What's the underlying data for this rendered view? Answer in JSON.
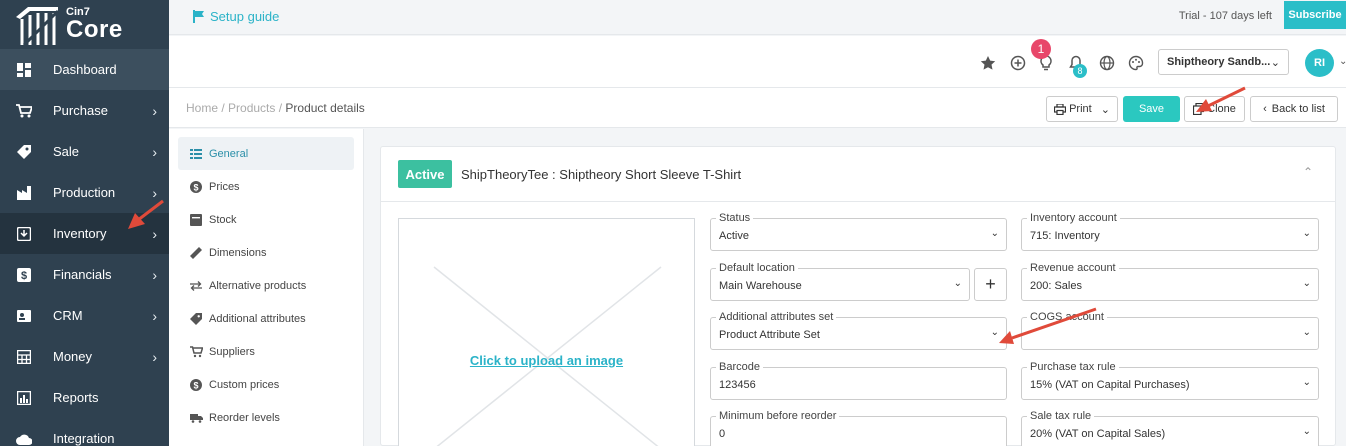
{
  "brand": {
    "small": "Cin7",
    "big": "Core"
  },
  "sidebar": {
    "items": [
      {
        "label": "Dashboard",
        "icon": "dashboard-icon",
        "glyph": "▦"
      },
      {
        "label": "Purchase",
        "icon": "cart-icon",
        "glyph": "🛒"
      },
      {
        "label": "Sale",
        "icon": "tag-icon",
        "glyph": "◆"
      },
      {
        "label": "Production",
        "icon": "factory-icon",
        "glyph": "▙"
      },
      {
        "label": "Inventory",
        "icon": "inventory-icon",
        "glyph": "▣"
      },
      {
        "label": "Financials",
        "icon": "dollar-icon",
        "glyph": "$"
      },
      {
        "label": "CRM",
        "icon": "contact-icon",
        "glyph": "▤"
      },
      {
        "label": "Money",
        "icon": "calculator-icon",
        "glyph": "▦"
      },
      {
        "label": "Reports",
        "icon": "report-icon",
        "glyph": "▥"
      },
      {
        "label": "Integration",
        "icon": "cloud-icon",
        "glyph": "☁"
      }
    ]
  },
  "topbar": {
    "setup_label": "Setup guide",
    "trial": "Trial - 107 days left",
    "subscribe": "Subscribe"
  },
  "header": {
    "notification_count": "1",
    "bell_count": "8",
    "company": "Shiptheory Sandb...",
    "avatar": "RI"
  },
  "breadcrumb": {
    "home": "Home",
    "products": "Products",
    "current": "Product details"
  },
  "actions": {
    "print": "Print",
    "save": "Save",
    "clone": "Clone",
    "back": "Back to list"
  },
  "subnav": {
    "items": [
      {
        "label": "General",
        "glyph": "☰"
      },
      {
        "label": "Prices",
        "glyph": "$"
      },
      {
        "label": "Stock",
        "glyph": "▤"
      },
      {
        "label": "Dimensions",
        "glyph": "✎"
      },
      {
        "label": "Alternative products",
        "glyph": "⇄"
      },
      {
        "label": "Additional attributes",
        "glyph": "◆"
      },
      {
        "label": "Suppliers",
        "glyph": "▚"
      },
      {
        "label": "Custom prices",
        "glyph": "$"
      },
      {
        "label": "Reorder levels",
        "glyph": "▬"
      }
    ]
  },
  "product": {
    "status_badge": "Active",
    "title": "ShipTheoryTee : Shiptheory Short Sleeve T-Shirt",
    "upload_link": "Click to upload an image"
  },
  "fields": {
    "status": {
      "label": "Status",
      "value": "Active"
    },
    "default_location": {
      "label": "Default location",
      "value": "Main Warehouse"
    },
    "attributes_set": {
      "label": "Additional attributes set",
      "value": "Product Attribute Set"
    },
    "barcode": {
      "label": "Barcode",
      "value": "123456"
    },
    "min_reorder": {
      "label": "Minimum before reorder",
      "value": "0"
    },
    "inventory_account": {
      "label": "Inventory account",
      "value": "715: Inventory"
    },
    "revenue_account": {
      "label": "Revenue account",
      "value": "200: Sales"
    },
    "cogs_account": {
      "label": "COGS account",
      "value": ""
    },
    "purchase_tax": {
      "label": "Purchase tax rule",
      "value": "15% (VAT on Capital Purchases)"
    },
    "sale_tax": {
      "label": "Sale tax rule",
      "value": "20% (VAT on Capital Sales)"
    }
  },
  "colors": {
    "sidebar": "#2f4150",
    "accent": "#2bbec8",
    "status": "#3cc0a0",
    "annotation": "#e04a3a"
  }
}
